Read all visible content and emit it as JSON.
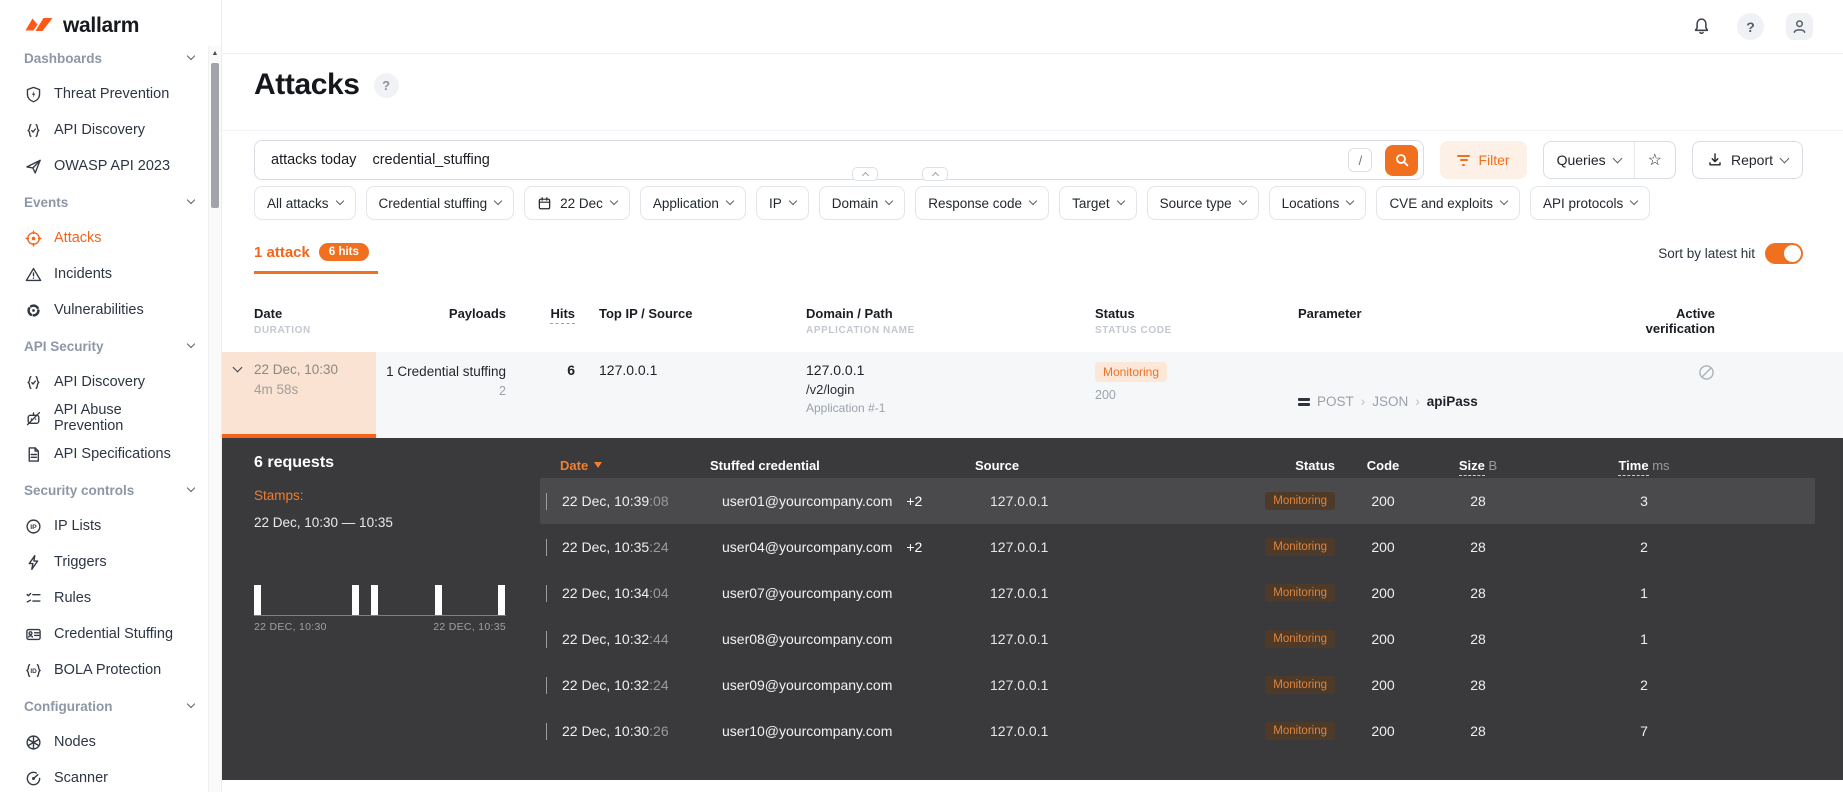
{
  "brand": {
    "name": "wallarm"
  },
  "topbar": {
    "icons": [
      "bell-icon",
      "help-icon",
      "user-icon"
    ]
  },
  "sidebar": {
    "sections": [
      {
        "label": "Dashboards",
        "items": [
          {
            "label": "Threat Prevention",
            "icon": "shield-icon"
          },
          {
            "label": "API Discovery",
            "icon": "braces-check-icon"
          },
          {
            "label": "OWASP API 2023",
            "icon": "paper-plane-icon"
          }
        ]
      },
      {
        "label": "Events",
        "items": [
          {
            "label": "Attacks",
            "icon": "target-icon",
            "active": true
          },
          {
            "label": "Incidents",
            "icon": "warning-triangle-icon"
          },
          {
            "label": "Vulnerabilities",
            "icon": "radiation-icon"
          }
        ]
      },
      {
        "label": "API Security",
        "items": [
          {
            "label": "API Discovery",
            "icon": "braces-check-icon"
          },
          {
            "label": "API Abuse Prevention",
            "icon": "bot-blocked-icon"
          },
          {
            "label": "API Specifications",
            "icon": "document-icon"
          }
        ]
      },
      {
        "label": "Security controls",
        "items": [
          {
            "label": "IP Lists",
            "icon": "ip-circle-icon"
          },
          {
            "label": "Triggers",
            "icon": "lightning-icon"
          },
          {
            "label": "Rules",
            "icon": "checklist-icon"
          },
          {
            "label": "Credential Stuffing",
            "icon": "id-card-icon"
          },
          {
            "label": "BOLA Protection",
            "icon": "braces-id-icon"
          }
        ]
      },
      {
        "label": "Configuration",
        "items": [
          {
            "label": "Nodes",
            "icon": "node-icon"
          },
          {
            "label": "Scanner",
            "icon": "radar-icon"
          }
        ]
      }
    ]
  },
  "header": {
    "title": "Attacks"
  },
  "search": {
    "tokens": [
      "attacks today",
      "credential_stuffing"
    ],
    "shortcut_key": "/"
  },
  "toolbar": {
    "filter": "Filter",
    "queries": "Queries",
    "star": "☆",
    "report": "Report"
  },
  "filters": [
    {
      "label": "All attacks"
    },
    {
      "label": "Credential stuffing"
    },
    {
      "label": "22 Dec",
      "icon": "calendar-icon"
    },
    {
      "label": "Application"
    },
    {
      "label": "IP"
    },
    {
      "label": "Domain"
    },
    {
      "label": "Response code"
    },
    {
      "label": "Target"
    },
    {
      "label": "Source type"
    },
    {
      "label": "Locations"
    },
    {
      "label": "CVE and exploits"
    },
    {
      "label": "API protocols"
    }
  ],
  "results_bar": {
    "attacks_label": "1 attack",
    "hits_badge": "6 hits",
    "sort_label": "Sort by latest hit",
    "sort_enabled": true
  },
  "attack_table": {
    "headers": {
      "date": "Date",
      "date_sub": "DURATION",
      "payloads": "Payloads",
      "hits": "Hits",
      "top_ip": "Top IP / Source",
      "domain": "Domain / Path",
      "domain_sub": "APPLICATION NAME",
      "status": "Status",
      "status_sub": "STATUS CODE",
      "parameter": "Parameter",
      "active_verification": "Active verification"
    },
    "row": {
      "date": "22 Dec, 10:30",
      "duration": "4m 58s",
      "payload": "1 Credential stuffing",
      "payload_sub": "2",
      "hits": "6",
      "top_ip": "127.0.0.1",
      "domain": "127.0.0.1",
      "path": "/v2/login",
      "application": "Application #-1",
      "status": "Monitoring",
      "status_code": "200",
      "parameter_method": "POST",
      "parameter_format": "JSON",
      "parameter_name": "apiPass",
      "separator": "›"
    }
  },
  "details": {
    "requests_count": "6 requests",
    "stamps_label": "Stamps:",
    "stamps_range": "22 Dec, 10:30 — 10:35",
    "histogram": {
      "type": "bar",
      "bar_positions_pct": [
        0,
        39,
        46.5,
        72,
        97
      ],
      "axis_start": "22 DEC, 10:30",
      "axis_end": "22 DEC, 10:35"
    },
    "table": {
      "headers": {
        "date": "Date",
        "credential": "Stuffed credential",
        "source": "Source",
        "status": "Status",
        "code": "Code",
        "size": "Size",
        "size_unit": "B",
        "time": "Time",
        "time_unit": "ms"
      },
      "rows": [
        {
          "date": "22 Dec, 10:39",
          "seconds": ":08",
          "credential": "user01@yourcompany.com",
          "extra": "+2",
          "source": "127.0.0.1",
          "status": "Monitoring",
          "code": "200",
          "size": "28",
          "time": "3",
          "selected": true
        },
        {
          "date": "22 Dec, 10:35",
          "seconds": ":24",
          "credential": "user04@yourcompany.com",
          "extra": "+2",
          "source": "127.0.0.1",
          "status": "Monitoring",
          "code": "200",
          "size": "28",
          "time": "2",
          "selected": false
        },
        {
          "date": "22 Dec, 10:34",
          "seconds": ":04",
          "credential": "user07@yourcompany.com",
          "extra": "",
          "source": "127.0.0.1",
          "status": "Monitoring",
          "code": "200",
          "size": "28",
          "time": "1",
          "selected": false
        },
        {
          "date": "22 Dec, 10:32",
          "seconds": ":44",
          "credential": "user08@yourcompany.com",
          "extra": "",
          "source": "127.0.0.1",
          "status": "Monitoring",
          "code": "200",
          "size": "28",
          "time": "1",
          "selected": false
        },
        {
          "date": "22 Dec, 10:32",
          "seconds": ":24",
          "credential": "user09@yourcompany.com",
          "extra": "",
          "source": "127.0.0.1",
          "status": "Monitoring",
          "code": "200",
          "size": "28",
          "time": "2",
          "selected": false
        },
        {
          "date": "22 Dec, 10:30",
          "seconds": ":26",
          "credential": "user10@yourcompany.com",
          "extra": "",
          "source": "127.0.0.1",
          "status": "Monitoring",
          "code": "200",
          "size": "28",
          "time": "7",
          "selected": false
        }
      ]
    }
  },
  "colors": {
    "accent": "#F5641A",
    "toggle_on": "#F07020",
    "panel_bg": "#3A3A3C",
    "badge_light_bg": "#FCE7D9",
    "badge_light_text": "#E8742C",
    "badge_dark_bg": "#4E3A28",
    "badge_dark_text": "#E0833C"
  }
}
